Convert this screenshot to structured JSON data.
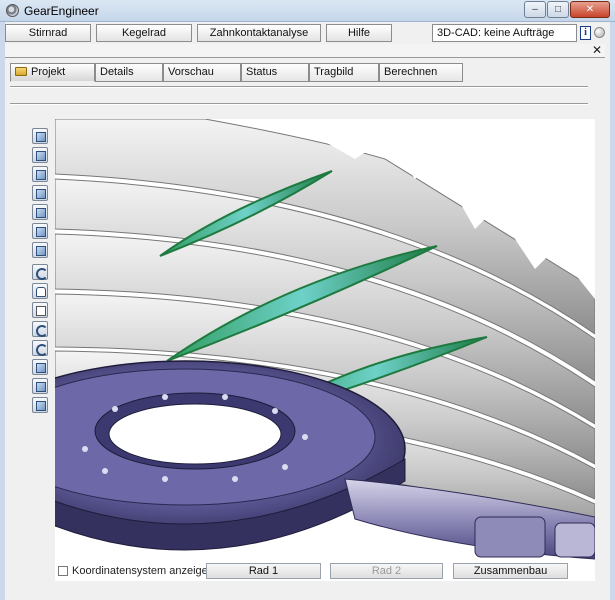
{
  "window": {
    "title": "GearEngineer",
    "min": "‒",
    "max": "□",
    "close": "✕"
  },
  "menu": {
    "items": [
      {
        "label": "Stirnrad"
      },
      {
        "label": "Kegelrad"
      },
      {
        "label": "Zahnkontaktanalyse"
      },
      {
        "label": "Hilfe"
      }
    ],
    "cad_status": "3D-CAD: keine Aufträge",
    "info": "i"
  },
  "panel": {
    "close": "✕"
  },
  "tabs": [
    {
      "label": "Projekt",
      "active": true
    },
    {
      "label": "Details"
    },
    {
      "label": "Vorschau"
    },
    {
      "label": "Status"
    },
    {
      "label": "Tragbild"
    },
    {
      "label": "Berechnen"
    }
  ],
  "toolbar": {
    "icons": [
      "view-front-icon",
      "view-back-icon",
      "view-left-icon",
      "view-right-icon",
      "view-top-icon",
      "view-bottom-icon",
      "view-iso-icon",
      "rotate-icon",
      "pan-hand-icon",
      "page-icon",
      "zoom-icon",
      "refresh-icon",
      "view-cube-icon",
      "view-cube2-icon",
      "home-icon"
    ]
  },
  "bottom": {
    "coord_label": "Koordinatensystem anzeigen",
    "rad1": "Rad 1",
    "rad2": "Rad 2",
    "assembly": "Zusammenbau"
  },
  "colors": {
    "contact": "#2f9c5e",
    "gear": "#4a4680",
    "tooth": "#c8c8c8"
  }
}
